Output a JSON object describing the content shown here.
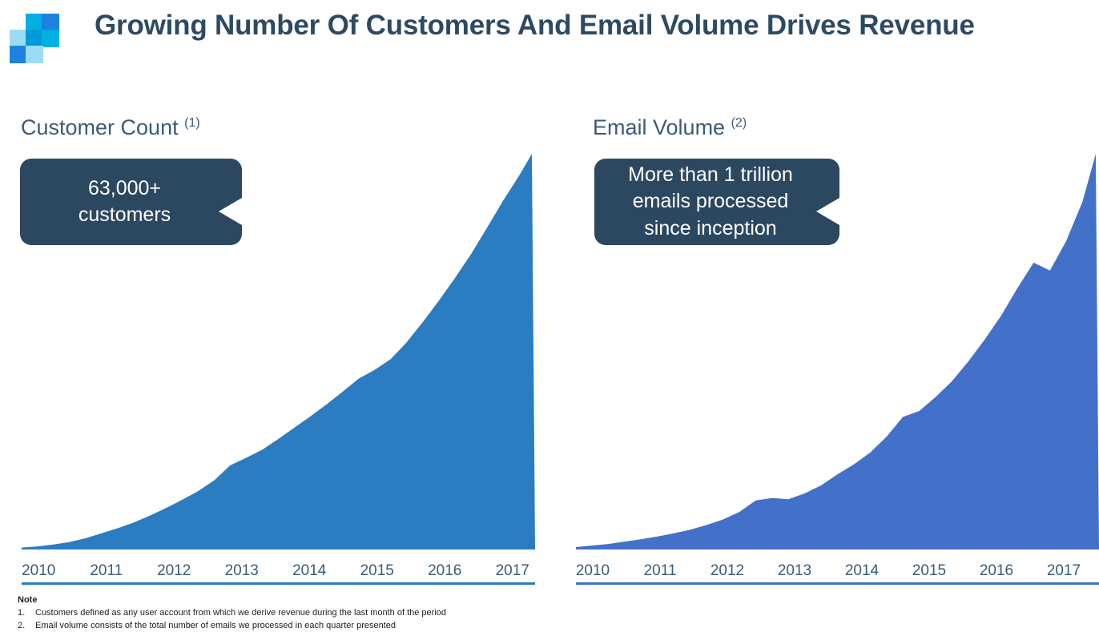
{
  "header": {
    "title": "Growing Number Of Customers And Email Volume Drives Revenue",
    "title_color": "#2d4a63",
    "logo": {
      "name": "company-logo",
      "tiles": [
        {
          "pos": "r0c1",
          "color": "#00b0e0"
        },
        {
          "pos": "r0c2",
          "color": "#1f81e0"
        },
        {
          "pos": "r1c0",
          "color": "#9bdcf5"
        },
        {
          "pos": "r1c1",
          "color": "#009ad6"
        },
        {
          "pos": "r1c2",
          "color": "#00b0e0"
        },
        {
          "pos": "r2c0",
          "color": "#1f81e0"
        },
        {
          "pos": "r2c1",
          "color": "#9bdcf5"
        }
      ]
    }
  },
  "panels": {
    "left": {
      "title": "Customer Count",
      "footnote_marker": "(1)",
      "callout": {
        "line1": "63,000+",
        "line2": "customers",
        "bg_color": "#2c4760"
      }
    },
    "right": {
      "title": "Email Volume",
      "footnote_marker": "(2)",
      "callout": {
        "line1": "More than 1 trillion",
        "line2": "emails processed",
        "line3": "since inception",
        "bg_color": "#2c4760"
      }
    }
  },
  "notes": {
    "heading": "Note",
    "items": [
      {
        "num": "1.",
        "text": "Customers defined as any user account from which we derive revenue during the last month of the period"
      },
      {
        "num": "2.",
        "text": "Email volume consists of the total number of emails we processed in each quarter presented"
      }
    ]
  },
  "chart_data": [
    {
      "id": "customer-count",
      "type": "area",
      "title": "Customer Count",
      "xlabel": "",
      "ylabel": "Customer Count",
      "grid": false,
      "legend": "none",
      "fill_color": "#2b7cc0",
      "axis_tick_labels": [
        "2010",
        "2011",
        "2012",
        "2013",
        "2014",
        "2015",
        "2016",
        "2017"
      ],
      "xlim": [
        2010,
        2018
      ],
      "ylim": [
        0,
        63000
      ],
      "annotation": "63,000+ customers",
      "x": [
        2010.0,
        2010.25,
        2010.5,
        2010.75,
        2011.0,
        2011.25,
        2011.5,
        2011.75,
        2012.0,
        2012.25,
        2012.5,
        2012.75,
        2013.0,
        2013.25,
        2013.5,
        2013.75,
        2014.0,
        2014.25,
        2014.5,
        2014.75,
        2015.0,
        2015.25,
        2015.5,
        2015.75,
        2016.0,
        2016.25,
        2016.5,
        2016.75,
        2017.0,
        2017.25,
        2017.5,
        2017.75,
        2017.95
      ],
      "values": [
        300,
        500,
        800,
        1200,
        1800,
        2600,
        3400,
        4300,
        5400,
        6600,
        7900,
        9300,
        11000,
        13400,
        14600,
        15900,
        17600,
        19400,
        21200,
        23100,
        25100,
        27200,
        28600,
        30300,
        33000,
        36200,
        39600,
        43200,
        47000,
        51200,
        55500,
        59500,
        63000
      ]
    },
    {
      "id": "email-volume",
      "type": "area",
      "title": "Email Volume",
      "xlabel": "",
      "ylabel": "Email Volume",
      "grid": false,
      "legend": "none",
      "fill_color": "#4370c8",
      "axis_tick_labels": [
        "2010",
        "2011",
        "2012",
        "2013",
        "2014",
        "2015",
        "2016",
        "2017"
      ],
      "xlim": [
        2010,
        2018
      ],
      "ylim": [
        0,
        100
      ],
      "annotation": "More than 1 trillion emails processed since inception",
      "x": [
        2010.0,
        2010.25,
        2010.5,
        2010.75,
        2011.0,
        2011.25,
        2011.5,
        2011.75,
        2012.0,
        2012.25,
        2012.5,
        2012.75,
        2013.0,
        2013.25,
        2013.5,
        2013.75,
        2014.0,
        2014.25,
        2014.5,
        2014.75,
        2015.0,
        2015.25,
        2015.5,
        2015.75,
        2016.0,
        2016.25,
        2016.5,
        2016.75,
        2017.0,
        2017.25,
        2017.5,
        2017.75,
        2017.95
      ],
      "values": [
        0.6,
        1.0,
        1.4,
        2.0,
        2.6,
        3.3,
        4.1,
        5.0,
        6.2,
        7.6,
        9.5,
        12.4,
        13.0,
        12.7,
        14.2,
        16.2,
        19.0,
        21.5,
        24.5,
        28.5,
        33.5,
        35.0,
        38.5,
        42.5,
        47.5,
        53.0,
        59.0,
        66.0,
        72.5,
        70.5,
        78.0,
        88.0,
        100.0
      ]
    }
  ]
}
